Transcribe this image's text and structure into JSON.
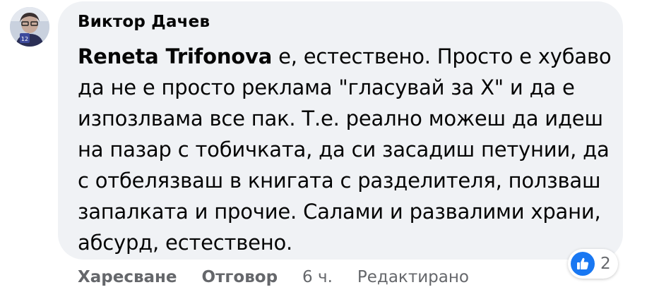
{
  "comment": {
    "author": "Виктор Дачев",
    "mention": "Reneta Trifonova",
    "text_lines": [
      " е, естествено. Просто е хубаво",
      "да не е просто реклама \"гласувай за Х\" и да е",
      "изпозлвама все пак. Т.е. реално можеш да идеш",
      "на пазар с тобичката, да си засадиш петунии, да",
      "с отбелязваш в книгата с разделителя, ползваш",
      "запалката и прочие. Салами и развалими храни,",
      "абсурд, естествено."
    ],
    "avatar_badge": "12"
  },
  "actions": {
    "like_label": "Харесване",
    "reply_label": "Отговор",
    "time": "6 ч.",
    "edited": "Редактирано"
  },
  "reactions": {
    "icon": "thumbs-up-icon",
    "count": "2"
  },
  "colors": {
    "bubble": "#f0f2f5",
    "text": "#050505",
    "meta": "#65676b",
    "like_blue": "#1877f2"
  }
}
